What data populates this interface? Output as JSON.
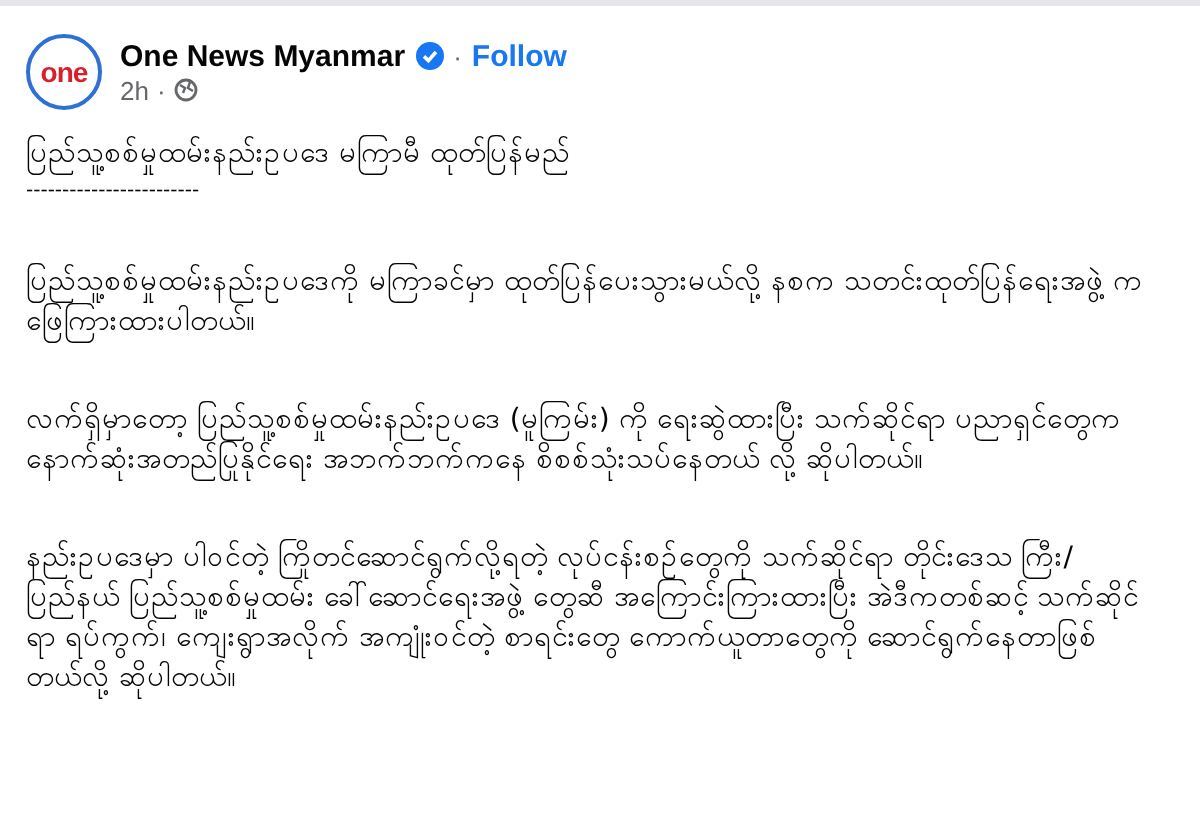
{
  "post": {
    "logo_text": "one",
    "author": "One News Myanmar",
    "verified": true,
    "follow_separator": "·",
    "follow": "Follow",
    "time": "2h",
    "time_separator": "·",
    "paragraphs": [
      {
        "kind": "title",
        "text": "ပြည်သူ့စစ်မှုထမ်းနည်းဥပဒေ မကြာမီ ထုတ်ပြန်မည်"
      },
      {
        "kind": "rule",
        "text": "------------------------"
      },
      {
        "kind": "body",
        "text": "ပြည်သူ့စစ်မှုထမ်းနည်းဥပဒေကို မကြာခင်မှာ ထုတ်ပြန်ပေးသွားမယ်လို့ နစက သတင်းထုတ်ပြန်ရေးအဖွဲ့ က ဖြေကြားထားပါတယ်။"
      },
      {
        "kind": "body",
        "text": "လက်ရှိမှာတော့ ပြည်သူ့စစ်မှုထမ်းနည်းဥပဒေ (မူကြမ်း) ကို ရေးဆွဲထားပြီး သက်ဆိုင်ရာ ပညာရှင်တွေက နောက်ဆုံးအတည်ပြုနိုင်ရေး အဘက်ဘက်ကနေ စိစစ်သုံးသပ်နေတယ် လို့ ဆိုပါတယ်။"
      },
      {
        "kind": "body",
        "text": "နည်းဥပဒေမှာ ပါဝင်တဲ့ ကြိုတင်ဆောင်ရွက်လို့ရတဲ့ လုပ်ငန်းစဉ်တွေကို သက်ဆိုင်ရာ တိုင်းဒေသ ကြီး/ ပြည်နယ် ပြည်သူ့စစ်မှုထမ်း ခေါ်ဆောင်ရေးအဖွဲ့ တွေဆီ အကြောင်းကြားထားပြီး အဲဒီကတစ်ဆင့် သက်ဆိုင် ရာ ရပ်ကွက်၊ ကျေးရွာအလိုက် အကျုံးဝင်တဲ့ စာရင်းတွေ ကောက်ယူတာတွေကို ဆောင်ရွက်နေတာဖြစ်တယ်လို့ ဆိုပါတယ်။"
      }
    ]
  }
}
